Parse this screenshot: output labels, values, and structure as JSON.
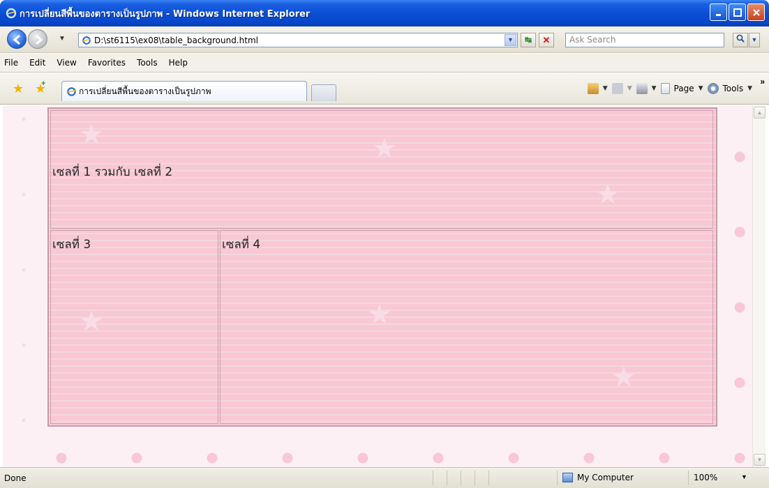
{
  "window": {
    "title": "การเปลี่ยนสีพื้นของตารางเป็นรูปภาพ - Windows Internet Explorer"
  },
  "address_bar": {
    "url": "D:\\st6115\\ex08\\table_background.html",
    "search_placeholder": "Ask Search"
  },
  "menu": {
    "items": [
      "File",
      "Edit",
      "View",
      "Favorites",
      "Tools",
      "Help"
    ]
  },
  "tab": {
    "label": "การเปลี่ยนสีพื้นของตารางเป็นรูปภาพ"
  },
  "command_bar": {
    "page_label": "Page",
    "tools_label": "Tools"
  },
  "table": {
    "cell_merged": "เซลที่ 1 รวมกับ เซลที่ 2",
    "cell_3": "เซลที่ 3",
    "cell_4": "เซลที่ 4"
  },
  "status": {
    "text": "Done",
    "zone": "My Computer",
    "zoom": "100%"
  },
  "colors": {
    "titlebar": "#0a4fd6",
    "table_bg": "#f8c8d4",
    "page_bg": "#fdf0f5"
  }
}
